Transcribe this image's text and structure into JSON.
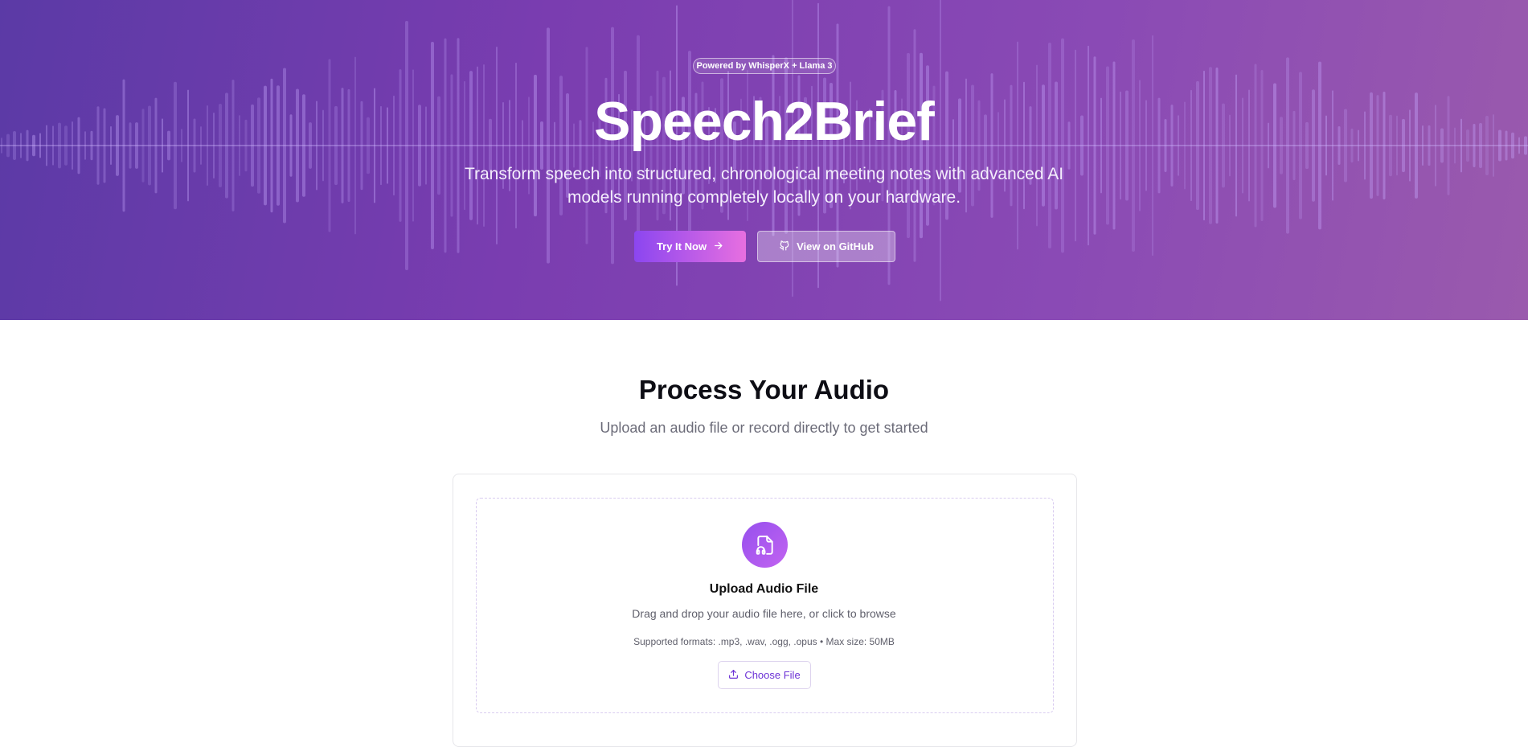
{
  "hero": {
    "badge": "Powered by WhisperX + Llama 3",
    "title": "Speech2Brief",
    "subtitle": "Transform speech into structured, chronological meeting notes with advanced AI models running completely locally on your hardware.",
    "try_button_label": "Try It Now",
    "try_button_icon": "arrow-right-icon",
    "github_button_label": "View on GitHub",
    "github_button_icon": "github-icon"
  },
  "process": {
    "title": "Process Your Audio",
    "subtitle": "Upload an audio file or record directly to get started"
  },
  "upload": {
    "icon": "audio-file-icon",
    "title": "Upload Audio File",
    "description": "Drag and drop your audio file here, or click to browse",
    "formats": "Supported formats: .mp3, .wav, .ogg, .opus • Max size: 50MB",
    "choose_button_label": "Choose File",
    "choose_button_icon": "upload-icon"
  },
  "colors": {
    "accent": "#8b46f0",
    "accent_pink": "#e76fe0",
    "hero_bg": "#7a3db0"
  }
}
